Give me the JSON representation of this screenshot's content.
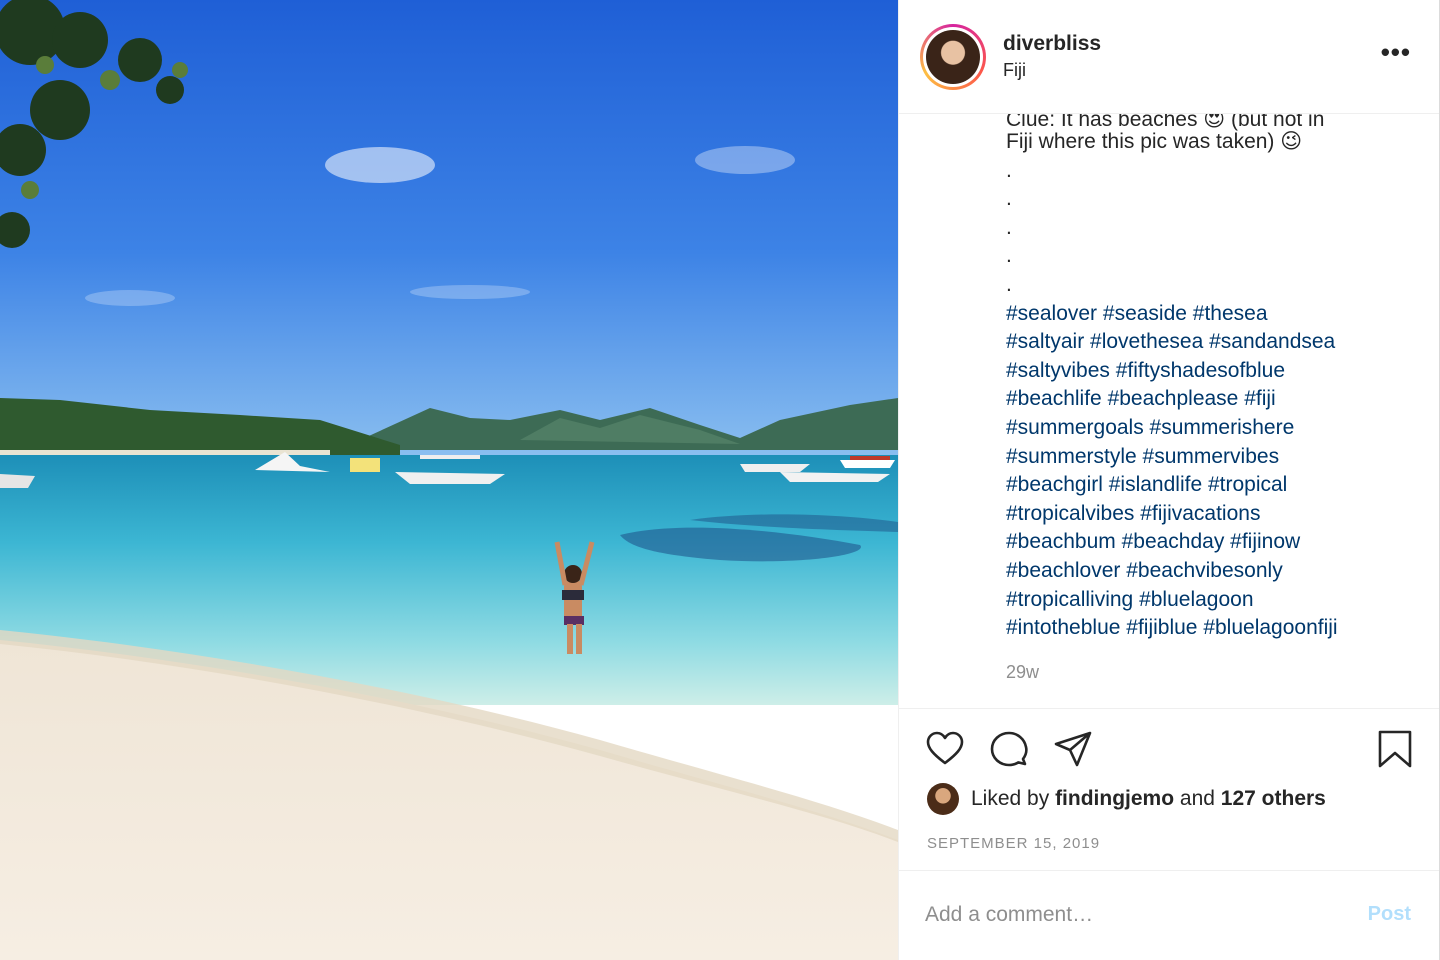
{
  "header": {
    "username": "diverbliss",
    "location": "Fiji",
    "more_label": "•••"
  },
  "caption": {
    "cut_line": "Clue: It has beaches 😍 (but not in",
    "line2": "Fiji where this pic was taken) 😉",
    "dots": [
      ".",
      ".",
      ".",
      ".",
      "."
    ],
    "hashtags": [
      "#sealover #seaside #thesea",
      "#saltyair #lovethesea #sandandsea",
      "#saltyvibes #fiftyshadesofblue",
      "#beachlife #beachplease #fiji",
      "#summergoals #summerishere",
      "#summerstyle #summervibes",
      "#beachgirl #islandlife #tropical",
      "#tropicalvibes #fijivacations",
      "#beachbum #beachday #fijinow",
      "#beachlover #beachvibesonly",
      "#tropicalliving #bluelagoon",
      "#intotheblue #fijiblue #bluelagoonfiji"
    ],
    "age": "29w"
  },
  "actions": {
    "icons": [
      "heart-icon",
      "comment-icon",
      "share-icon",
      "bookmark-icon"
    ],
    "liked_prefix": "Liked by",
    "liked_user": "findingjemo",
    "liked_and": "and",
    "liked_others": "127 others",
    "date": "SEPTEMBER 15, 2019"
  },
  "comment": {
    "placeholder": "Add a comment…",
    "post_label": "Post"
  },
  "colors": {
    "link": "#00376b",
    "muted": "#8e8e8e",
    "post_disabled": "#b2dffc"
  }
}
